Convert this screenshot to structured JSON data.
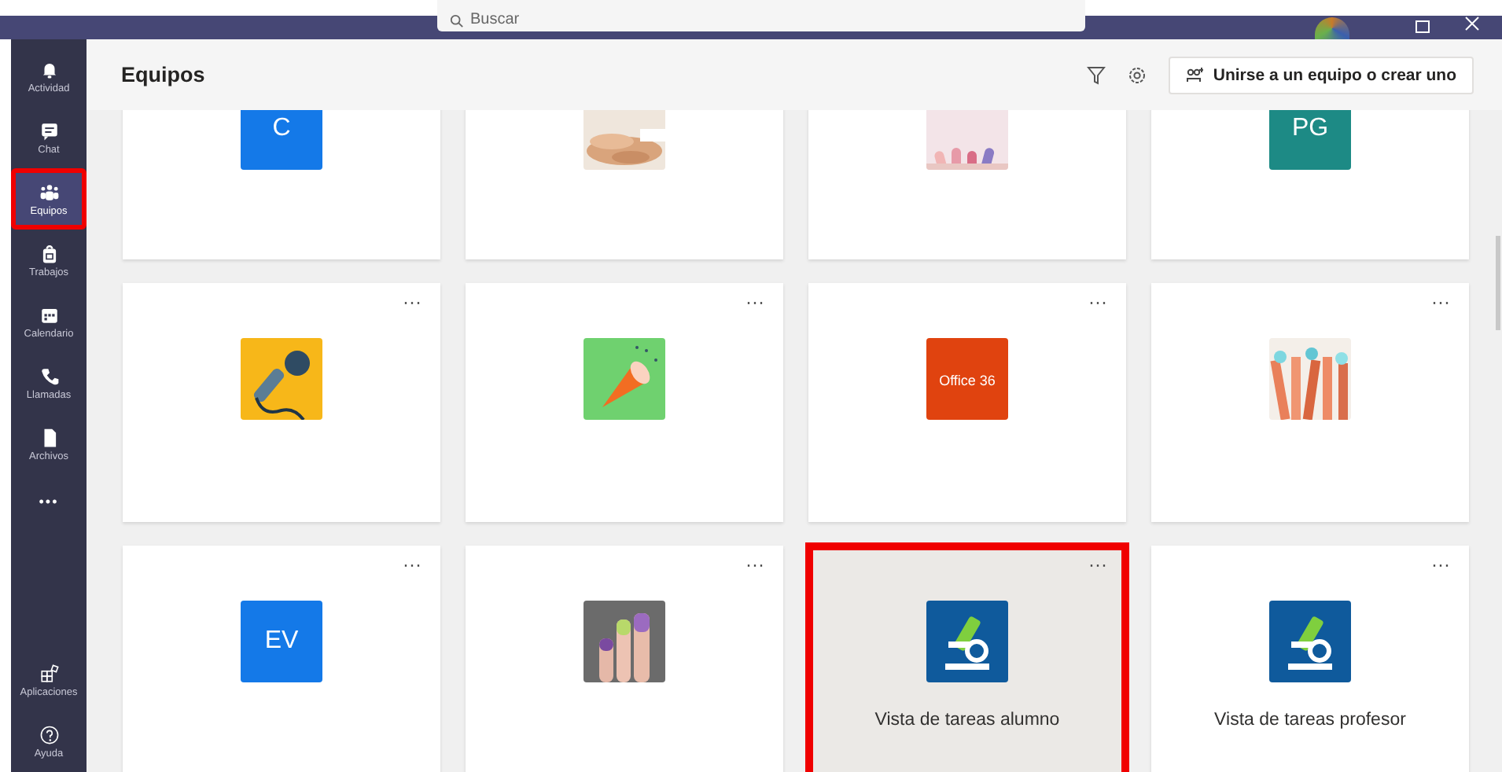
{
  "top_bar": {
    "search": {
      "placeholder": "Buscar"
    }
  },
  "rail": {
    "items": [
      {
        "label": "Actividad",
        "kind": "bell",
        "selected": false,
        "highlighted": false
      },
      {
        "label": "Chat",
        "kind": "chat",
        "selected": false,
        "highlighted": false
      },
      {
        "label": "Equipos",
        "kind": "teams",
        "selected": true,
        "highlighted": true
      },
      {
        "label": "Trabajos",
        "kind": "bag",
        "selected": false,
        "highlighted": false
      },
      {
        "label": "Calendario",
        "kind": "calendar",
        "selected": false,
        "highlighted": false
      },
      {
        "label": "Llamadas",
        "kind": "phone",
        "selected": false,
        "highlighted": false
      },
      {
        "label": "Archivos",
        "kind": "file",
        "selected": false,
        "highlighted": false
      }
    ],
    "more": "•••",
    "bottom_items": [
      {
        "label": "Aplicaciones",
        "kind": "apps"
      },
      {
        "label": "Ayuda",
        "kind": "help"
      }
    ]
  },
  "header": {
    "title": "Equipos",
    "join_button": "Unirse a un equipo o crear uno"
  },
  "teams": [
    {
      "kind": "initials",
      "initials": "C",
      "color": "#1479e8",
      "highlighted": false
    },
    {
      "kind": "picture",
      "highlighted": false
    },
    {
      "kind": "picture",
      "highlighted": false
    },
    {
      "kind": "initials",
      "initials": "PG",
      "color": "#1d8a85",
      "highlighted": false
    },
    {
      "kind": "microphone",
      "color": "#f7b719",
      "menu": "···",
      "highlighted": false
    },
    {
      "kind": "megaphone",
      "color": "#6fd16f",
      "menu": "···",
      "highlighted": false
    },
    {
      "kind": "office",
      "color": "#e0430f",
      "logo_text": "Office 36",
      "menu": "···",
      "highlighted": false
    },
    {
      "kind": "picture",
      "menu": "···",
      "highlighted": false
    },
    {
      "kind": "initials",
      "initials": "EV",
      "color": "#1479e8",
      "menu": "···",
      "highlighted": false
    },
    {
      "kind": "picture",
      "menu": "···",
      "highlighted": false
    },
    {
      "kind": "microscope",
      "color": "#0f5a9c",
      "menu": "···",
      "name": "Vista de tareas alumno",
      "highlighted": true
    },
    {
      "kind": "microscope",
      "color": "#0f5a9c",
      "menu": "···",
      "name": "Vista de tareas profesor",
      "highlighted": false
    }
  ]
}
